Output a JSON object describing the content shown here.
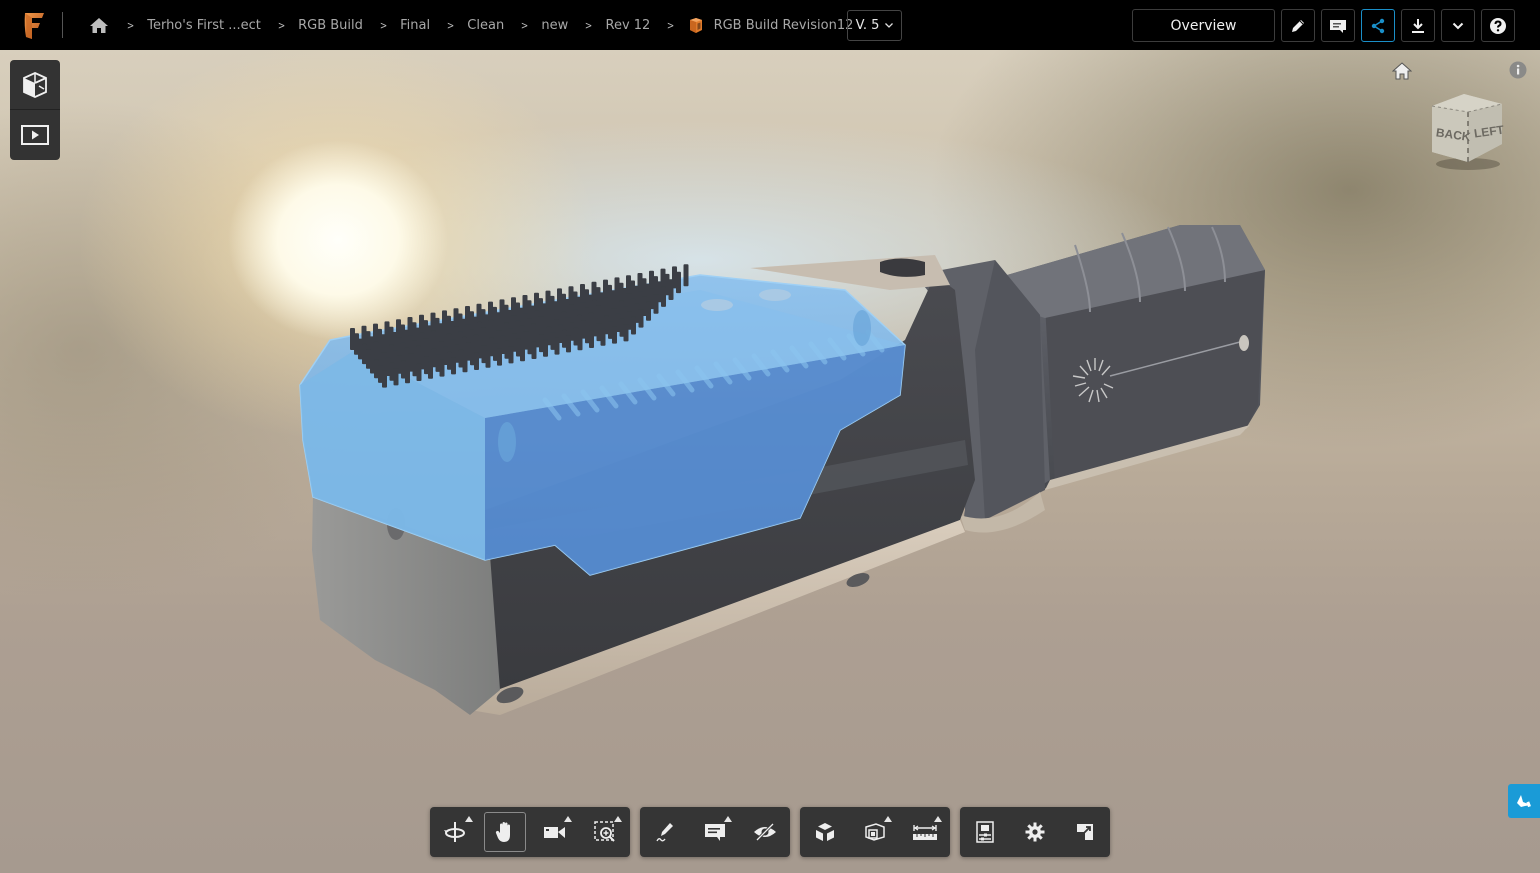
{
  "app": {
    "name": "Autodesk Fusion",
    "brand_color": "#e07b2b"
  },
  "breadcrumb": {
    "items": [
      {
        "label": "Terho's First ...ect"
      },
      {
        "label": "RGB Build"
      },
      {
        "label": "Final"
      },
      {
        "label": "Clean"
      },
      {
        "label": "new"
      },
      {
        "label": "Rev 12"
      }
    ],
    "current": "RGB Build Revision12"
  },
  "version": {
    "label": "V. 5"
  },
  "header_tools": {
    "overview_label": "Overview",
    "buttons": [
      {
        "name": "edit",
        "icon": "pencil-icon"
      },
      {
        "name": "comment",
        "icon": "comment-icon"
      },
      {
        "name": "share",
        "icon": "share-icon",
        "active": true
      },
      {
        "name": "download",
        "icon": "download-icon"
      },
      {
        "name": "more",
        "icon": "chevron-down-icon"
      },
      {
        "name": "help",
        "icon": "help-icon"
      }
    ],
    "active_color": "#1a8fc8"
  },
  "viewer": {
    "left_panel": [
      {
        "name": "model-browser",
        "icon": "model-cube-icon"
      },
      {
        "name": "animations",
        "icon": "play-icon"
      }
    ],
    "viewcube": {
      "faces_visible": [
        "BACK",
        "LEFT"
      ]
    },
    "selection_color": "#5a9ae0"
  },
  "bottom_toolbar": {
    "groups": [
      {
        "name": "navigation",
        "tools": [
          {
            "name": "orbit",
            "icon": "orbit-icon",
            "flyout": true
          },
          {
            "name": "pan",
            "icon": "hand-icon",
            "active": true
          },
          {
            "name": "camera",
            "icon": "camera-icon",
            "flyout": true
          },
          {
            "name": "fit-to-view",
            "icon": "zoom-window-icon",
            "flyout": true
          }
        ]
      },
      {
        "name": "review",
        "tools": [
          {
            "name": "markup",
            "icon": "markup-pencil-icon"
          },
          {
            "name": "comment",
            "icon": "comment-icon",
            "flyout": true
          },
          {
            "name": "hide",
            "icon": "eye-slash-icon"
          }
        ]
      },
      {
        "name": "model",
        "tools": [
          {
            "name": "explode",
            "icon": "explode-icon"
          },
          {
            "name": "section",
            "icon": "section-icon",
            "flyout": true
          },
          {
            "name": "measure",
            "icon": "measure-icon",
            "flyout": true
          }
        ]
      },
      {
        "name": "settings",
        "tools": [
          {
            "name": "properties",
            "icon": "properties-icon"
          },
          {
            "name": "settings",
            "icon": "gear-icon"
          },
          {
            "name": "fullscreen",
            "icon": "fullscreen-icon"
          }
        ]
      }
    ]
  },
  "feedback": {
    "icon": "megaphone-icon",
    "color": "#1a9bd7"
  }
}
